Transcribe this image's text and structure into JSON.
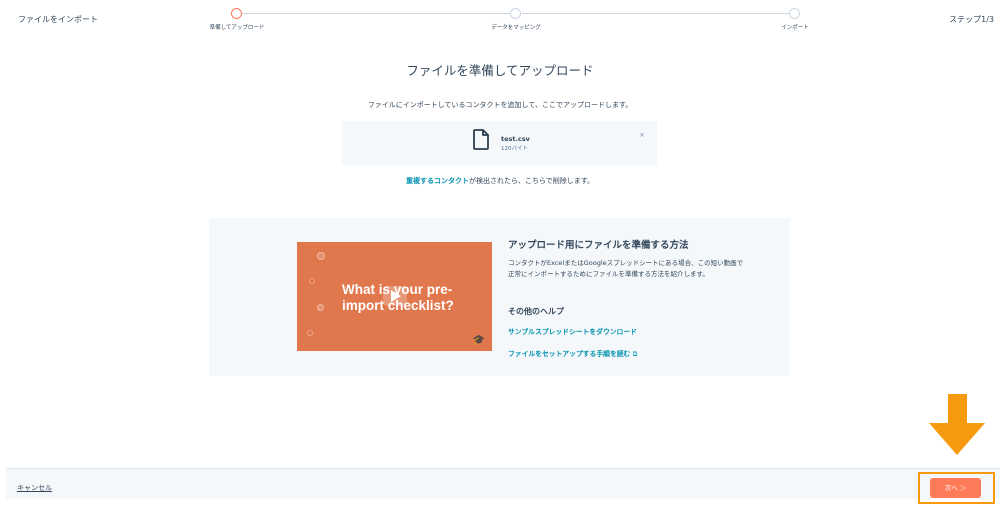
{
  "header": {
    "title": "ファイルをインポート",
    "step_indicator": "ステップ1/3"
  },
  "stepper": {
    "steps": [
      {
        "label": "準備してアップロード",
        "active": true
      },
      {
        "label": "データをマッピング",
        "active": false
      },
      {
        "label": "インポート",
        "active": false
      }
    ]
  },
  "main": {
    "title": "ファイルを準備してアップロード",
    "description": "ファイルにインポートしているコンタクトを追加して、ここでアップロードします。",
    "file": {
      "name": "test.csv",
      "size": "120バイト",
      "icon": "file-icon",
      "close": "×"
    },
    "duplicate_link": "重複するコンタクト",
    "duplicate_text": "が検出されたら、こちらで削除します。"
  },
  "help": {
    "video_text": "What is your pre-import checklist?",
    "title": "アップロード用にファイルを準備する方法",
    "body": "コンタクトがExcelまたはGoogleスプレッドシートにある場合、この短い動画で正常にインポートするためにファイルを準備する方法を紹介します。",
    "subheading": "その他のヘルプ",
    "links": [
      "サンプルスプレッドシートをダウンロード",
      "ファイルをセットアップする手順を読む"
    ]
  },
  "footer": {
    "cancel_label": "キャンセル",
    "next_label": "次へ ＞"
  },
  "colors": {
    "accent": "#ff7a59",
    "link": "#0091ae",
    "annotation": "#f79a0f",
    "panel_bg": "#f5f8fa",
    "video_bg": "#e1774c"
  }
}
